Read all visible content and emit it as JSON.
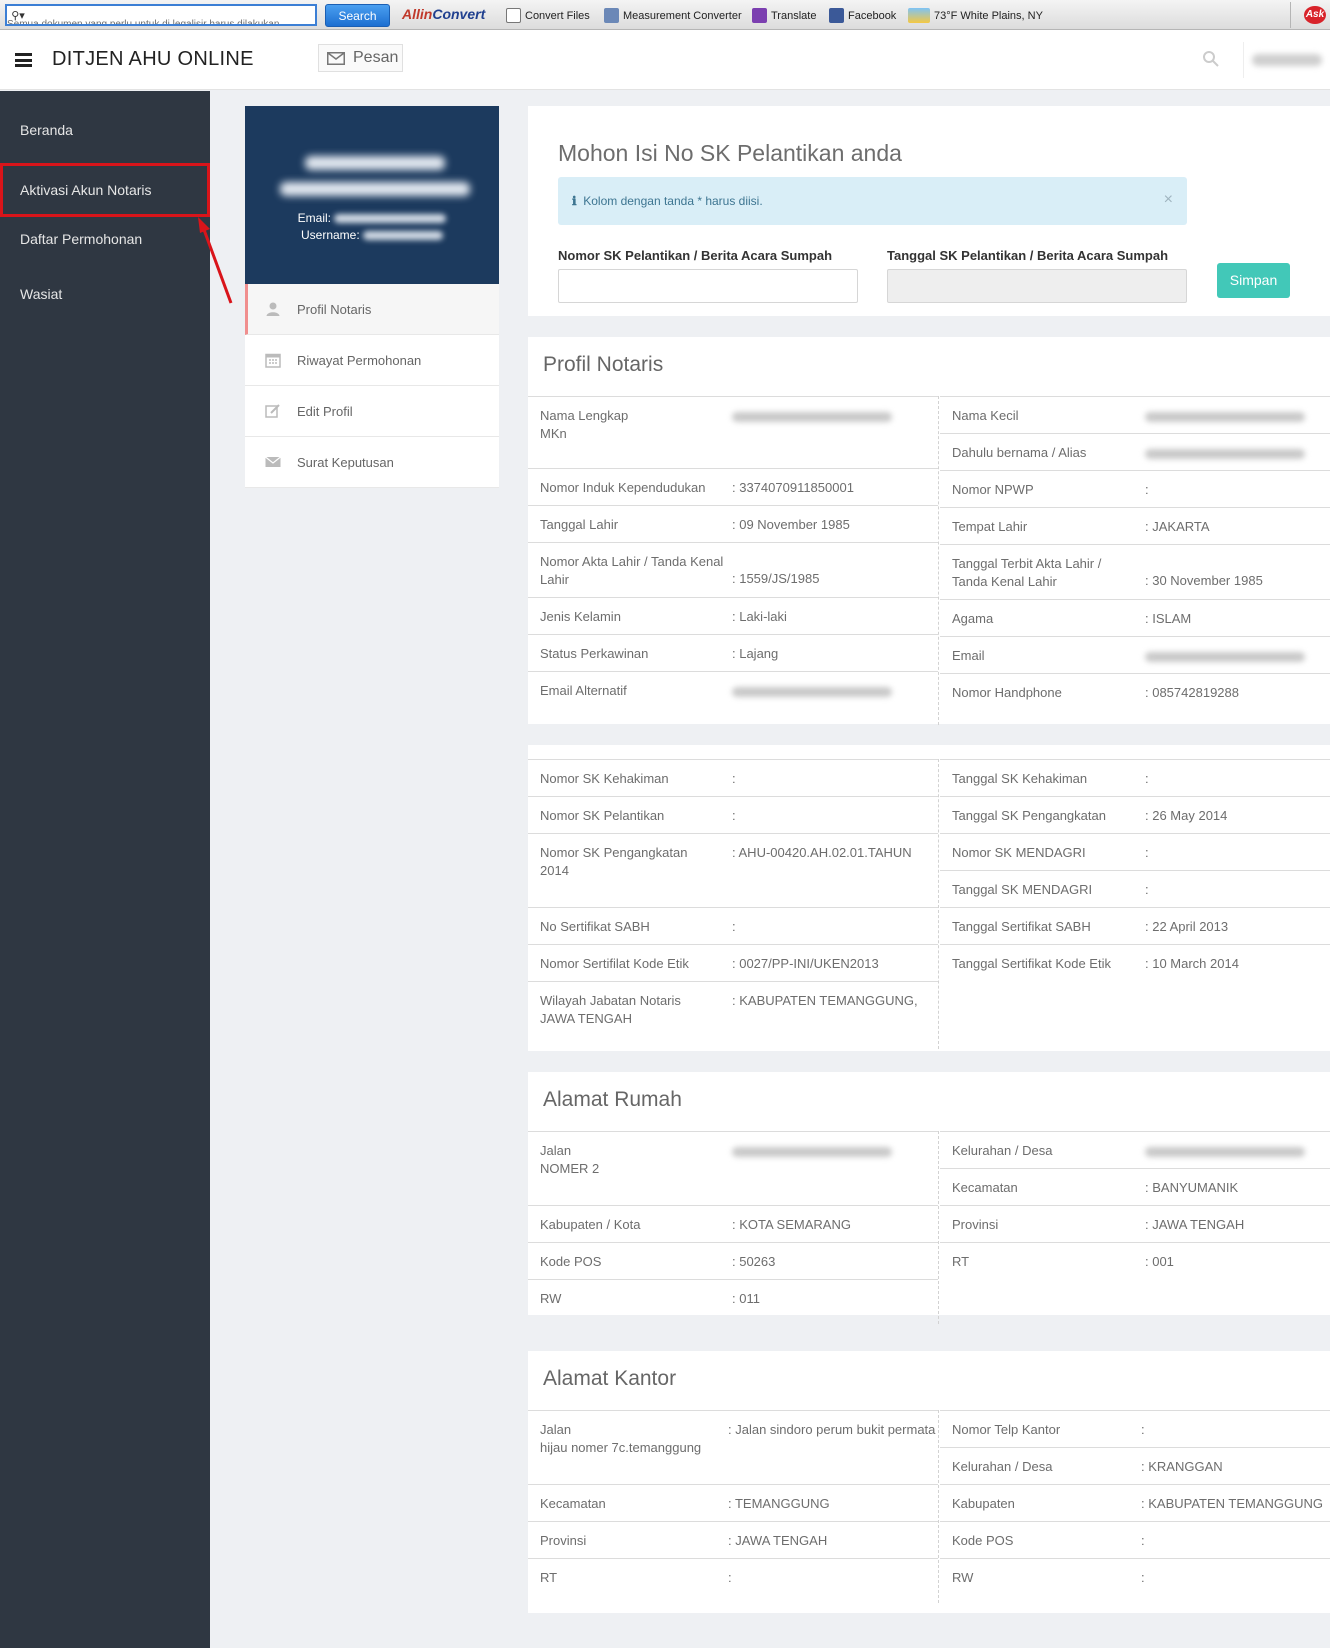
{
  "browser": {
    "search_value": "Semua dokumen yang perlu untuk di legalisir harus dilakukan",
    "search_button": "Search",
    "logo_left": "Allin",
    "logo_right": "Convert",
    "links": [
      "Convert Files",
      "Measurement Converter",
      "Translate",
      "Facebook",
      "73°F White Plains, NY"
    ],
    "ask": "Ask"
  },
  "header": {
    "title": "DITJEN AHU ONLINE",
    "pesan": "Pesan"
  },
  "sidebar": {
    "items": [
      "Beranda",
      "Aktivasi Akun Notaris",
      "Daftar Permohonan",
      "Wasiat"
    ]
  },
  "profile_card": {
    "email_label": "Email:",
    "username_label": "Username:"
  },
  "profile_menu": [
    "Profil Notaris",
    "Riwayat Permohonan",
    "Edit Profil",
    "Surat Keputusan"
  ],
  "sk_form": {
    "title": "Mohon Isi No SK Pelantikan anda",
    "alert": "Kolom dengan tanda * harus diisi.",
    "label_nomor": "Nomor SK Pelantikan / Berita Acara Sumpah",
    "label_tanggal": "Tanggal SK Pelantikan / Berita Acara Sumpah",
    "submit": "Simpan"
  },
  "profil": {
    "title": "Profil Notaris",
    "left": [
      {
        "label": "Nama Lengkap",
        "label2": "MKn",
        "value": "",
        "blur": true
      },
      {
        "label": "Nomor Induk Kependudukan",
        "value": ": 3374070911850001"
      },
      {
        "label": "Tanggal Lahir",
        "value": ": 09 November 1985"
      },
      {
        "label": "Nomor Akta Lahir / Tanda Kenal",
        "label2": "Lahir",
        "value": ": 1559/JS/1985"
      },
      {
        "label": "Jenis Kelamin",
        "value": ": Laki-laki"
      },
      {
        "label": "Status Perkawinan",
        "value": ": Lajang"
      },
      {
        "label": "Email Alternatif",
        "value": "",
        "blur": true
      }
    ],
    "right": [
      {
        "label": "Nama Kecil",
        "value": "",
        "blur": true
      },
      {
        "label": "Dahulu bernama / Alias",
        "value": "",
        "blur": true
      },
      {
        "label": "Nomor NPWP",
        "value": ":"
      },
      {
        "label": "Tempat Lahir",
        "value": ": JAKARTA"
      },
      {
        "label": "Tanggal Terbit Akta Lahir /",
        "label2": "Tanda Kenal Lahir",
        "value": ": 30 November 1985"
      },
      {
        "label": "Agama",
        "value": ": ISLAM"
      },
      {
        "label": "Email",
        "value": "",
        "blur": true
      },
      {
        "label": "Nomor Handphone",
        "value": ": 085742819288"
      }
    ]
  },
  "sk": {
    "left": [
      {
        "label": "Nomor SK Kehakiman",
        "value": ":"
      },
      {
        "label": "Nomor SK Pelantikan",
        "value": ":"
      },
      {
        "label": "Nomor SK Pengangkatan",
        "label2": "2014",
        "value": ": AHU-00420.AH.02.01.TAHUN"
      },
      {
        "label": "No Sertifikat SABH",
        "value": ":"
      },
      {
        "label": "Nomor Sertifilat Kode Etik",
        "value": ": 0027/PP-INI/UKEN2013"
      },
      {
        "label": "Wilayah Jabatan Notaris",
        "label2": "JAWA TENGAH",
        "value": ": KABUPATEN TEMANGGUNG,"
      }
    ],
    "right": [
      {
        "label": "Tanggal SK Kehakiman",
        "value": ":"
      },
      {
        "label": "Tanggal SK Pengangkatan",
        "value": ": 26 May 2014"
      },
      {
        "label": "Nomor SK MENDAGRI",
        "value": ":"
      },
      {
        "label": "Tanggal SK MENDAGRI",
        "value": ":"
      },
      {
        "label": "Tanggal Sertifikat SABH",
        "value": ": 22 April 2013"
      },
      {
        "label": "Tanggal Sertifikat Kode Etik",
        "value": ": 10 March 2014"
      }
    ]
  },
  "rumah": {
    "title": "Alamat Rumah",
    "left": [
      {
        "label": "Jalan",
        "label2": "NOMER 2",
        "value": "",
        "blur": true
      },
      {
        "label": "Kabupaten / Kota",
        "value": ": KOTA SEMARANG"
      },
      {
        "label": "Kode POS",
        "value": ": 50263"
      },
      {
        "label": "RW",
        "value": ": 011"
      }
    ],
    "right": [
      {
        "label": "Kelurahan / Desa",
        "value": "",
        "blur": true
      },
      {
        "label": "Kecamatan",
        "value": ": BANYUMANIK"
      },
      {
        "label": "Provinsi",
        "value": ": JAWA TENGAH"
      },
      {
        "label": "RT",
        "value": ": 001"
      }
    ]
  },
  "kantor": {
    "title": "Alamat Kantor",
    "left": [
      {
        "label": "Jalan",
        "label2": "hijau nomer 7c.temanggung",
        "value": ": Jalan sindoro perum bukit permata"
      },
      {
        "label": "Kecamatan",
        "value": ": TEMANGGUNG"
      },
      {
        "label": "Provinsi",
        "value": ": JAWA TENGAH"
      },
      {
        "label": "RT",
        "value": ":"
      }
    ],
    "right": [
      {
        "label": "Nomor Telp Kantor",
        "value": ":"
      },
      {
        "label": "Kelurahan / Desa",
        "value": ": KRANGGAN"
      },
      {
        "label": "Kabupaten",
        "value": ": KABUPATEN TEMANGGUNG"
      },
      {
        "label": "Kode POS",
        "value": ":"
      },
      {
        "label": "RW",
        "value": ":"
      }
    ]
  }
}
